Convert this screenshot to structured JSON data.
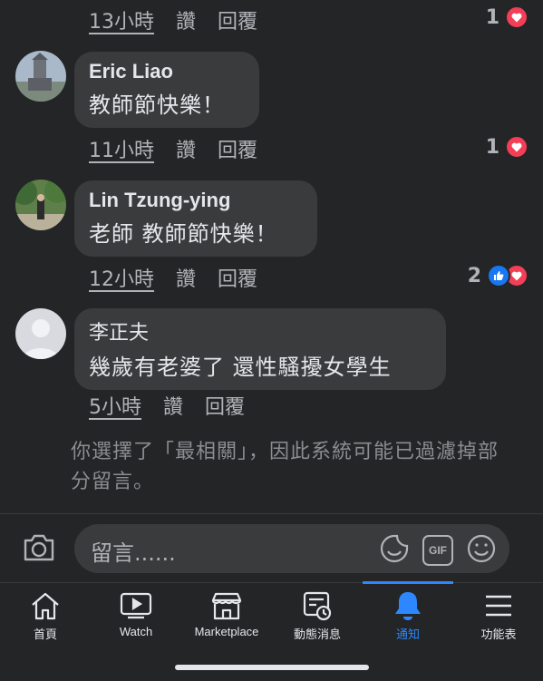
{
  "comments_top": {
    "time": "13小時",
    "like": "讚",
    "reply": "回覆",
    "reaction_count": "1"
  },
  "comments": [
    {
      "name": "Eric Liao",
      "text": "教師節快樂！",
      "time": "11小時",
      "like": "讚",
      "reply": "回覆",
      "reaction_count": "1",
      "reactions": [
        "heart"
      ]
    },
    {
      "name": "Lin Tzung-ying",
      "text": "老師 教師節快樂！",
      "time": "12小時",
      "like": "讚",
      "reply": "回覆",
      "reaction_count": "2",
      "reactions": [
        "like",
        "heart"
      ]
    },
    {
      "name": "李正夫",
      "text": "幾歲有老婆了 還性騷擾女學生",
      "time": "5小時",
      "like": "讚",
      "reply": "回覆",
      "reaction_count": "",
      "reactions": []
    }
  ],
  "notice": "你選擇了「最相關」，因此系統可能已過濾掉部分留言。",
  "composer": {
    "placeholder": "留言......",
    "gif_label": "GIF"
  },
  "tabs": [
    {
      "label": "首頁",
      "icon": "home-icon"
    },
    {
      "label": "Watch",
      "icon": "watch-icon"
    },
    {
      "label": "Marketplace",
      "icon": "marketplace-icon"
    },
    {
      "label": "動態消息",
      "icon": "news-feed-icon"
    },
    {
      "label": "通知",
      "icon": "bell-icon",
      "active": true
    },
    {
      "label": "功能表",
      "icon": "menu-icon"
    }
  ],
  "colors": {
    "background": "#242526",
    "bubble": "#3a3b3c",
    "accent": "#2d88ff",
    "heart": "#f33e58",
    "like": "#1877f2"
  }
}
